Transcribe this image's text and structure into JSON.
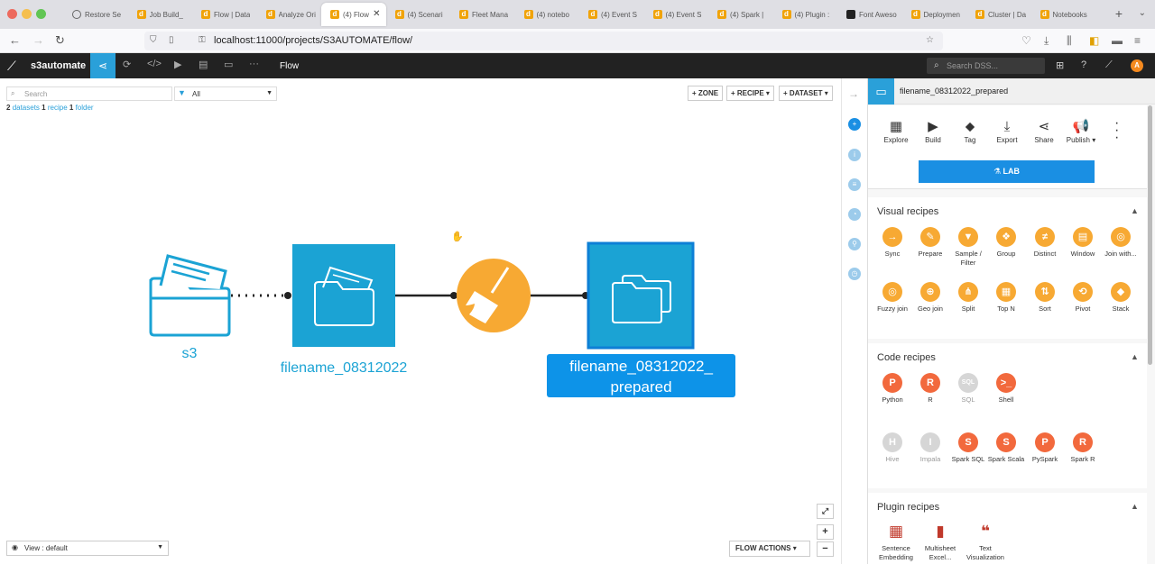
{
  "browser": {
    "tabs": [
      {
        "label": "Restore Se",
        "fav": "clock",
        "active": false
      },
      {
        "label": "Job Build_",
        "fav": "d",
        "active": false
      },
      {
        "label": "Flow | Data",
        "fav": "d",
        "active": false
      },
      {
        "label": "Analyze Ori",
        "fav": "d",
        "active": false
      },
      {
        "label": "(4) Flow",
        "fav": "d",
        "active": true
      },
      {
        "label": "(4) Scenari",
        "fav": "d",
        "active": false
      },
      {
        "label": "Fleet Mana",
        "fav": "d",
        "active": false
      },
      {
        "label": "(4) notebo",
        "fav": "d",
        "active": false
      },
      {
        "label": "(4) Event S",
        "fav": "d",
        "active": false
      },
      {
        "label": "(4) Event S",
        "fav": "d",
        "active": false
      },
      {
        "label": "(4) Spark |",
        "fav": "d",
        "active": false
      },
      {
        "label": "(4) Plugin :",
        "fav": "d",
        "active": false
      },
      {
        "label": "Font Aweso",
        "fav": "blk",
        "active": false
      },
      {
        "label": "Deploymen",
        "fav": "d",
        "active": false
      },
      {
        "label": "Cluster | Da",
        "fav": "d",
        "active": false
      },
      {
        "label": "Notebooks",
        "fav": "d",
        "active": false
      }
    ],
    "url": "localhost:11000/projects/S3AUTOMATE/flow/"
  },
  "dss": {
    "project": "s3automate",
    "page": "Flow",
    "search_placeholder": "Search DSS..."
  },
  "canvas": {
    "search_placeholder": "Search",
    "filter_value": "All",
    "summary": {
      "n_datasets": "2",
      "datasets": "datasets",
      "n_recipe": "1",
      "recipe": "recipe",
      "n_folder": "1",
      "folder": "folder"
    },
    "buttons": {
      "zone": "+ ZONE",
      "recipe": "+ RECIPE ▾",
      "dataset": "+ DATASET ▾"
    },
    "nodes": {
      "s3": "s3",
      "dataset1": "filename_08312022",
      "dataset2_line1": "filename_08312022_",
      "dataset2_line2": "prepared"
    },
    "view": "View : default",
    "flow_actions": "FLOW ACTIONS ▾"
  },
  "panel": {
    "title": "filename_08312022_prepared",
    "actions": [
      "Explore",
      "Build",
      "Tag",
      "Export",
      "Share",
      "Publish ▾"
    ],
    "lab": "LAB",
    "visual_title": "Visual recipes",
    "visual": [
      {
        "label": "Sync",
        "icon": "→"
      },
      {
        "label": "Prepare",
        "icon": "✎"
      },
      {
        "label": "Sample / Filter",
        "icon": "▼"
      },
      {
        "label": "Group",
        "icon": "❖"
      },
      {
        "label": "Distinct",
        "icon": "≠"
      },
      {
        "label": "Window",
        "icon": "▤"
      },
      {
        "label": "Join with...",
        "icon": "◎"
      },
      {
        "label": "Fuzzy join",
        "icon": "◎"
      },
      {
        "label": "Geo join",
        "icon": "⊕"
      },
      {
        "label": "Split",
        "icon": "⋔"
      },
      {
        "label": "Top N",
        "icon": "▦"
      },
      {
        "label": "Sort",
        "icon": "⇅"
      },
      {
        "label": "Pivot",
        "icon": "⟲"
      },
      {
        "label": "Stack",
        "icon": "◆"
      }
    ],
    "code_title": "Code recipes",
    "code": [
      {
        "label": "Python",
        "icon": "P",
        "disabled": false
      },
      {
        "label": "R",
        "icon": "R",
        "disabled": false
      },
      {
        "label": "SQL",
        "icon": "SQL",
        "disabled": true
      },
      {
        "label": "Shell",
        "icon": ">_",
        "disabled": false
      },
      {
        "label": "Hive",
        "icon": "H",
        "disabled": true
      },
      {
        "label": "Impala",
        "icon": "I",
        "disabled": true
      },
      {
        "label": "Spark SQL",
        "icon": "S",
        "disabled": false
      },
      {
        "label": "Spark Scala",
        "icon": "S",
        "disabled": false
      },
      {
        "label": "PySpark",
        "icon": "P",
        "disabled": false
      },
      {
        "label": "Spark R",
        "icon": "R",
        "disabled": false
      }
    ],
    "plugin_title": "Plugin recipes",
    "plugin": [
      {
        "label": "Sentence Embedding",
        "icon": "▦"
      },
      {
        "label": "Multisheet Excel...",
        "icon": "▮"
      },
      {
        "label": "Text Visualization",
        "icon": "❝"
      }
    ]
  },
  "colors": {
    "dss_blue": "#2aa0d9",
    "recipe_orange": "#f7a933",
    "code_orange": "#f2693d",
    "selected_blue": "#0d93e8"
  }
}
